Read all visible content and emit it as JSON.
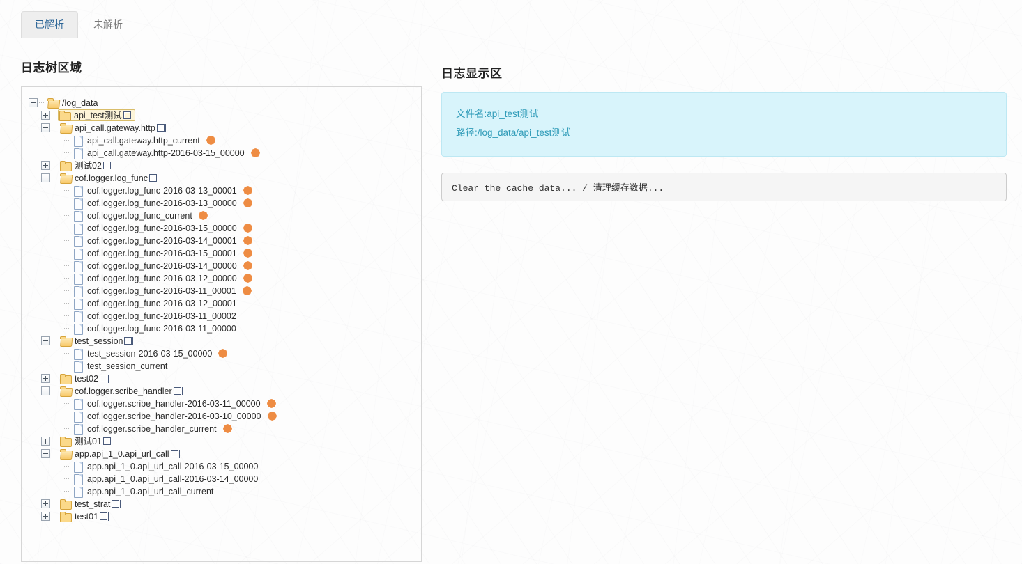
{
  "tabs": [
    {
      "label": "已解析",
      "active": true
    },
    {
      "label": "未解析",
      "active": false
    }
  ],
  "left": {
    "section_title": "日志树区域"
  },
  "right": {
    "section_title": "日志显示区",
    "info": {
      "filename_line": "文件名:api_test测试",
      "path_line": "路径:/log_data/api_test测试"
    },
    "console_text": "Clear the cache data... / 清理缓存数据..."
  },
  "colors": {
    "accent_info_bg": "#d8f4fb",
    "accent_info_text": "#2f9bb8",
    "selected_bg": "#fdf5d9",
    "selected_border": "#d9bd6a",
    "marker": "#f0914a",
    "folder": "#fbd98a",
    "tab_active_text": "#2a6496"
  },
  "tree": [
    {
      "depth": 0,
      "type": "folder-open",
      "toggle": "minus",
      "label": "/log_data",
      "tofu": false,
      "marker": false,
      "selected": false
    },
    {
      "depth": 1,
      "type": "folder",
      "toggle": "plus",
      "label": "api_test测试",
      "tofu": true,
      "marker": false,
      "selected": true
    },
    {
      "depth": 1,
      "type": "folder-open",
      "toggle": "minus",
      "label": "api_call.gateway.http",
      "tofu": true,
      "marker": false,
      "selected": false
    },
    {
      "depth": 2,
      "type": "file",
      "toggle": "none",
      "label": "api_call.gateway.http_current",
      "tofu": false,
      "marker": true,
      "selected": false
    },
    {
      "depth": 2,
      "type": "file",
      "toggle": "none",
      "label": "api_call.gateway.http-2016-03-15_00000",
      "tofu": false,
      "marker": true,
      "selected": false
    },
    {
      "depth": 1,
      "type": "folder",
      "toggle": "plus",
      "label": "测试02",
      "tofu": true,
      "marker": false,
      "selected": false
    },
    {
      "depth": 1,
      "type": "folder-open",
      "toggle": "minus",
      "label": "cof.logger.log_func",
      "tofu": true,
      "marker": false,
      "selected": false
    },
    {
      "depth": 2,
      "type": "file",
      "toggle": "none",
      "label": "cof.logger.log_func-2016-03-13_00001",
      "tofu": false,
      "marker": true,
      "selected": false
    },
    {
      "depth": 2,
      "type": "file",
      "toggle": "none",
      "label": "cof.logger.log_func-2016-03-13_00000",
      "tofu": false,
      "marker": true,
      "selected": false
    },
    {
      "depth": 2,
      "type": "file",
      "toggle": "none",
      "label": "cof.logger.log_func_current",
      "tofu": false,
      "marker": true,
      "selected": false
    },
    {
      "depth": 2,
      "type": "file",
      "toggle": "none",
      "label": "cof.logger.log_func-2016-03-15_00000",
      "tofu": false,
      "marker": true,
      "selected": false
    },
    {
      "depth": 2,
      "type": "file",
      "toggle": "none",
      "label": "cof.logger.log_func-2016-03-14_00001",
      "tofu": false,
      "marker": true,
      "selected": false
    },
    {
      "depth": 2,
      "type": "file",
      "toggle": "none",
      "label": "cof.logger.log_func-2016-03-15_00001",
      "tofu": false,
      "marker": true,
      "selected": false
    },
    {
      "depth": 2,
      "type": "file",
      "toggle": "none",
      "label": "cof.logger.log_func-2016-03-14_00000",
      "tofu": false,
      "marker": true,
      "selected": false
    },
    {
      "depth": 2,
      "type": "file",
      "toggle": "none",
      "label": "cof.logger.log_func-2016-03-12_00000",
      "tofu": false,
      "marker": true,
      "selected": false
    },
    {
      "depth": 2,
      "type": "file",
      "toggle": "none",
      "label": "cof.logger.log_func-2016-03-11_00001",
      "tofu": false,
      "marker": true,
      "selected": false
    },
    {
      "depth": 2,
      "type": "file",
      "toggle": "none",
      "label": "cof.logger.log_func-2016-03-12_00001",
      "tofu": false,
      "marker": false,
      "selected": false
    },
    {
      "depth": 2,
      "type": "file",
      "toggle": "none",
      "label": "cof.logger.log_func-2016-03-11_00002",
      "tofu": false,
      "marker": false,
      "selected": false
    },
    {
      "depth": 2,
      "type": "file",
      "toggle": "none",
      "label": "cof.logger.log_func-2016-03-11_00000",
      "tofu": false,
      "marker": false,
      "selected": false
    },
    {
      "depth": 1,
      "type": "folder-open",
      "toggle": "minus",
      "label": "test_session",
      "tofu": true,
      "marker": false,
      "selected": false
    },
    {
      "depth": 2,
      "type": "file",
      "toggle": "none",
      "label": "test_session-2016-03-15_00000",
      "tofu": false,
      "marker": true,
      "selected": false
    },
    {
      "depth": 2,
      "type": "file",
      "toggle": "none",
      "label": "test_session_current",
      "tofu": false,
      "marker": false,
      "selected": false
    },
    {
      "depth": 1,
      "type": "folder",
      "toggle": "plus",
      "label": "test02",
      "tofu": true,
      "marker": false,
      "selected": false
    },
    {
      "depth": 1,
      "type": "folder-open",
      "toggle": "minus",
      "label": "cof.logger.scribe_handler",
      "tofu": true,
      "marker": false,
      "selected": false
    },
    {
      "depth": 2,
      "type": "file",
      "toggle": "none",
      "label": "cof.logger.scribe_handler-2016-03-11_00000",
      "tofu": false,
      "marker": true,
      "selected": false
    },
    {
      "depth": 2,
      "type": "file",
      "toggle": "none",
      "label": "cof.logger.scribe_handler-2016-03-10_00000",
      "tofu": false,
      "marker": true,
      "selected": false
    },
    {
      "depth": 2,
      "type": "file",
      "toggle": "none",
      "label": "cof.logger.scribe_handler_current",
      "tofu": false,
      "marker": true,
      "selected": false
    },
    {
      "depth": 1,
      "type": "folder",
      "toggle": "plus",
      "label": "测试01",
      "tofu": true,
      "marker": false,
      "selected": false
    },
    {
      "depth": 1,
      "type": "folder-open",
      "toggle": "minus",
      "label": "app.api_1_0.api_url_call",
      "tofu": true,
      "marker": false,
      "selected": false
    },
    {
      "depth": 2,
      "type": "file",
      "toggle": "none",
      "label": "app.api_1_0.api_url_call-2016-03-15_00000",
      "tofu": false,
      "marker": false,
      "selected": false
    },
    {
      "depth": 2,
      "type": "file",
      "toggle": "none",
      "label": "app.api_1_0.api_url_call-2016-03-14_00000",
      "tofu": false,
      "marker": false,
      "selected": false
    },
    {
      "depth": 2,
      "type": "file",
      "toggle": "none",
      "label": "app.api_1_0.api_url_call_current",
      "tofu": false,
      "marker": false,
      "selected": false
    },
    {
      "depth": 1,
      "type": "folder",
      "toggle": "plus",
      "label": "test_strat",
      "tofu": true,
      "marker": false,
      "selected": false
    },
    {
      "depth": 1,
      "type": "folder",
      "toggle": "plus",
      "label": "test01",
      "tofu": true,
      "marker": false,
      "selected": false
    }
  ]
}
